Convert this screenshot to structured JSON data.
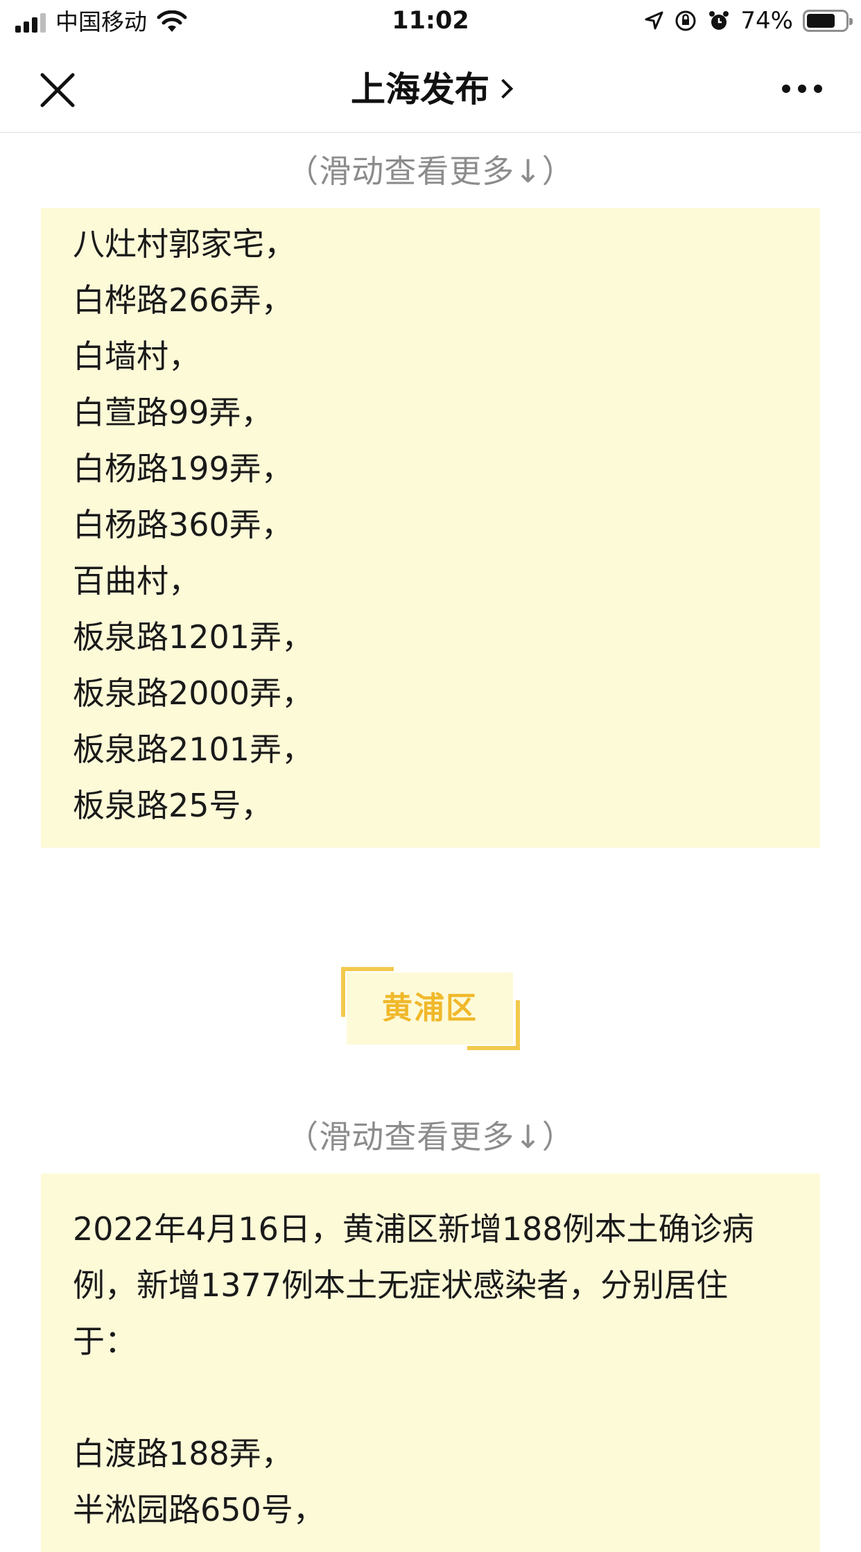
{
  "status_bar": {
    "carrier": "中国移动",
    "time": "11:02",
    "battery": "74%",
    "battery_level": 0.74
  },
  "nav": {
    "title": "上海发布"
  },
  "article": {
    "scroll_hint_1": "（滑动查看更多↓）",
    "list_1": [
      "八灶村郭家宅，",
      "白桦路266弄，",
      "白墙村，",
      "白萱路99弄，",
      "白杨路199弄，",
      "白杨路360弄，",
      "百曲村，",
      "板泉路1201弄，",
      "板泉路2000弄，",
      "板泉路2101弄，",
      "板泉路25号，"
    ],
    "district": "黄浦区",
    "scroll_hint_2": "（滑动查看更多↓）",
    "intro": "2022年4月16日，黄浦区新增188例本土确诊病例，新增1377例本土无症状感染者，分别居住于：",
    "list_2": [
      "白渡路188弄，",
      "半淞园路650号，"
    ]
  },
  "colors": {
    "box_bg": "#fdfad8",
    "accent": "#f0b82a",
    "hint": "#8c8c8c"
  }
}
